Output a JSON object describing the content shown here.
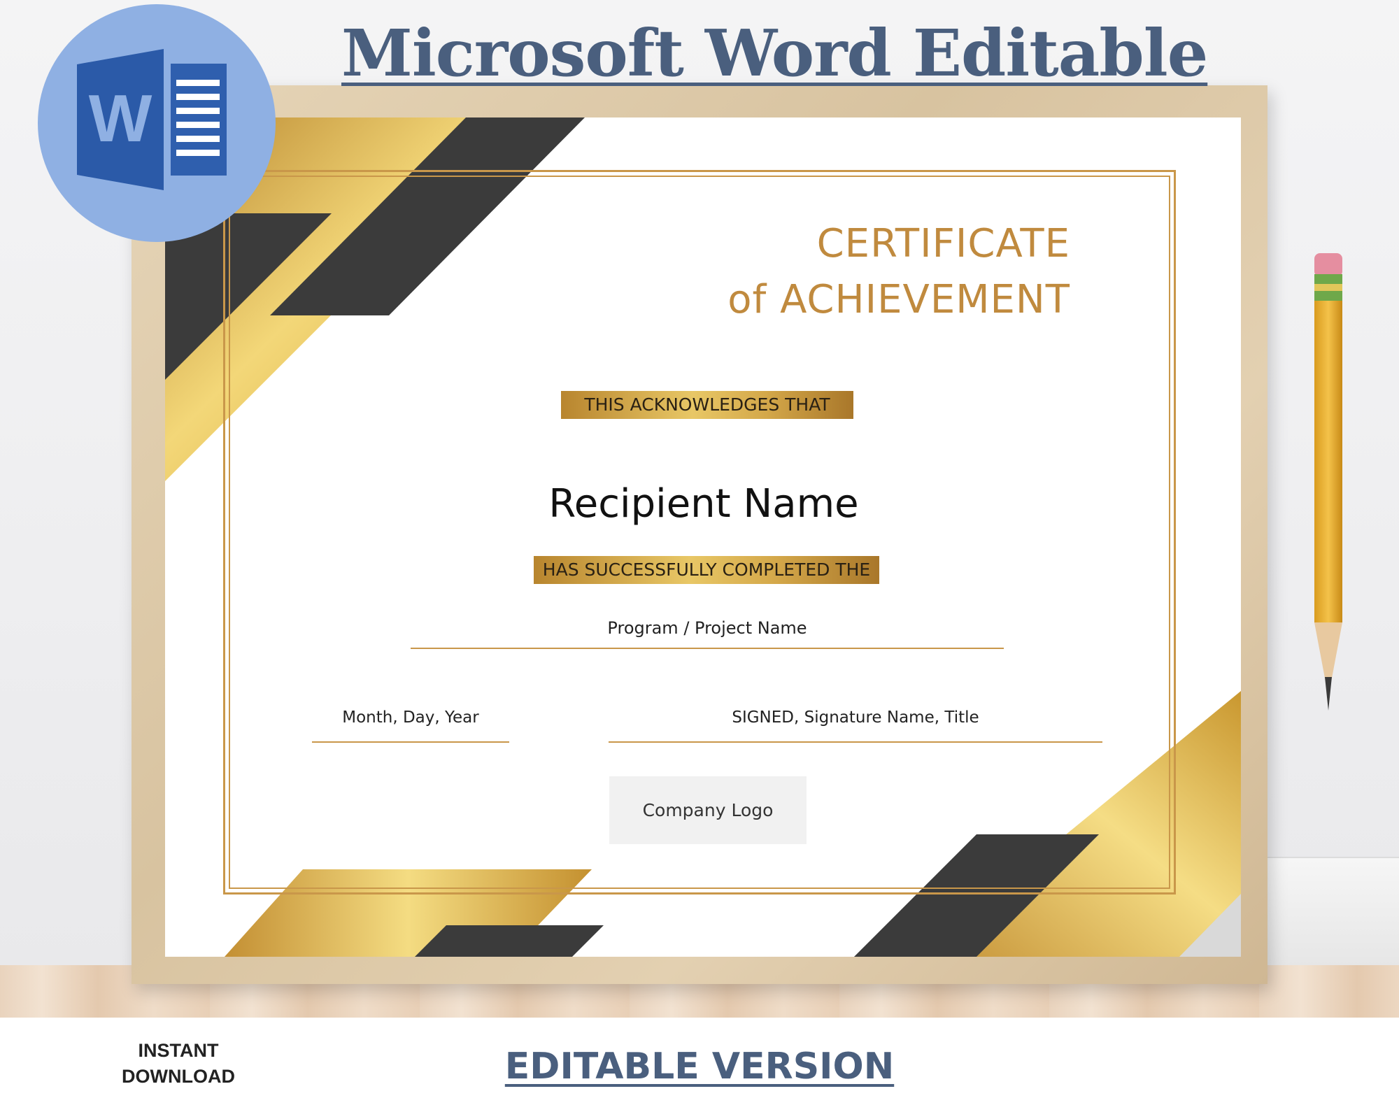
{
  "header": {
    "title": "Microsoft Word Editable",
    "app_icon": "microsoft-word-icon",
    "app_icon_letter": "W"
  },
  "certificate": {
    "title_line1": "CERTIFICATE",
    "title_line2": "of ACHIEVEMENT",
    "acknowledges": "THIS ACKNOWLEDGES THAT",
    "recipient": "Recipient Name",
    "completed": "HAS SUCCESSFULLY COMPLETED THE",
    "program": "Program / Project Name",
    "date": "Month, Day, Year",
    "signed": "SIGNED, Signature Name, Title",
    "logo": "Company Logo"
  },
  "footer": {
    "instant_download_line1": "INSTANT",
    "instant_download_line2": "DOWNLOAD",
    "editable_version": "EDITABLE VERSION"
  },
  "colors": {
    "gold": "#c9974a",
    "dark_stripe": "#3b3b3b",
    "heading_blue": "#4a5f7e",
    "word_badge": "#8fb0e3",
    "word_blue": "#2f5fae"
  }
}
